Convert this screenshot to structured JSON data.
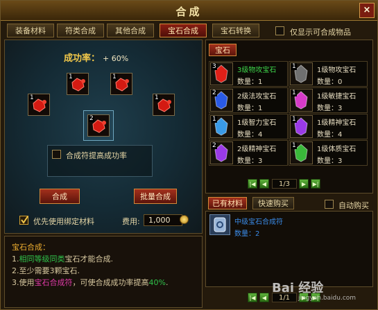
{
  "window": {
    "title": "合成",
    "close": "×"
  },
  "tabs": [
    "装备材料",
    "符类合成",
    "其他合成",
    "宝石合成",
    "宝石转换"
  ],
  "active_tab": 3,
  "only_show_label": "仅显示可合成物品",
  "success_rate": {
    "label": "成功率：",
    "value": "+ 60%"
  },
  "slots": {
    "top_left": {
      "count": "1"
    },
    "top_mid_left": {
      "count": "1"
    },
    "top_mid_right": {
      "count": "1"
    },
    "top_right": {
      "count": "1"
    },
    "mid_left": {
      "count": "1"
    },
    "center_result": {
      "count": "2"
    }
  },
  "boost_label": "合成符提高成功率",
  "buttons": {
    "compose": "合成",
    "batch": "批量合成"
  },
  "prefer_bound_label": "优先使用绑定材料",
  "fee": {
    "label": "费用:",
    "value": "1,000"
  },
  "info": {
    "heading": "宝石合成：",
    "line1_prefix": "1.",
    "line1_hl": "相同等级同类",
    "line1_suffix": "宝石才能合成.",
    "line2": "2.至少需要3颗宝石.",
    "line3_prefix": "3.使用",
    "line3_hl": "宝石合成符",
    "line3_mid": "，可使合成成功率提高",
    "line3_pct": "40%",
    "line3_end": "."
  },
  "gem_tab": "宝石",
  "gems": [
    {
      "count": "3",
      "name": "3级物攻宝石",
      "qty": "数量：1",
      "color": "#e02018",
      "highlight": true
    },
    {
      "count": "1",
      "name": "1级物攻宝石",
      "qty": "数量：0",
      "color": "#707070",
      "highlight": false
    },
    {
      "count": "2",
      "name": "2级法攻宝石",
      "qty": "数量：1",
      "color": "#2a5ae6",
      "highlight": false
    },
    {
      "count": "1",
      "name": "1级敏捷宝石",
      "qty": "数量：3",
      "color": "#d63ac8",
      "highlight": false
    },
    {
      "count": "1",
      "name": "1级智力宝石",
      "qty": "数量：4",
      "color": "#3a9ae6",
      "highlight": false
    },
    {
      "count": "1",
      "name": "1级精神宝石",
      "qty": "数量：4",
      "color": "#9a3ae6",
      "highlight": false
    },
    {
      "count": "2",
      "name": "2级精神宝石",
      "qty": "数量：3",
      "color": "#9a3ae6",
      "highlight": false
    },
    {
      "count": "1",
      "name": "1级体质宝石",
      "qty": "数量：3",
      "color": "#3ab83a",
      "highlight": false
    }
  ],
  "pager_top": "1/3",
  "pager_bottom": "1/1",
  "owned_tabs": {
    "owned": "已有材料",
    "quick_buy": "快速购买"
  },
  "auto_buy_label": "自动购买",
  "owned_item": {
    "name": "中级宝石合成符",
    "qty": "数量：2"
  },
  "watermark": {
    "text": "Bai 经验",
    "sub": "jingyan.baidu.com"
  }
}
